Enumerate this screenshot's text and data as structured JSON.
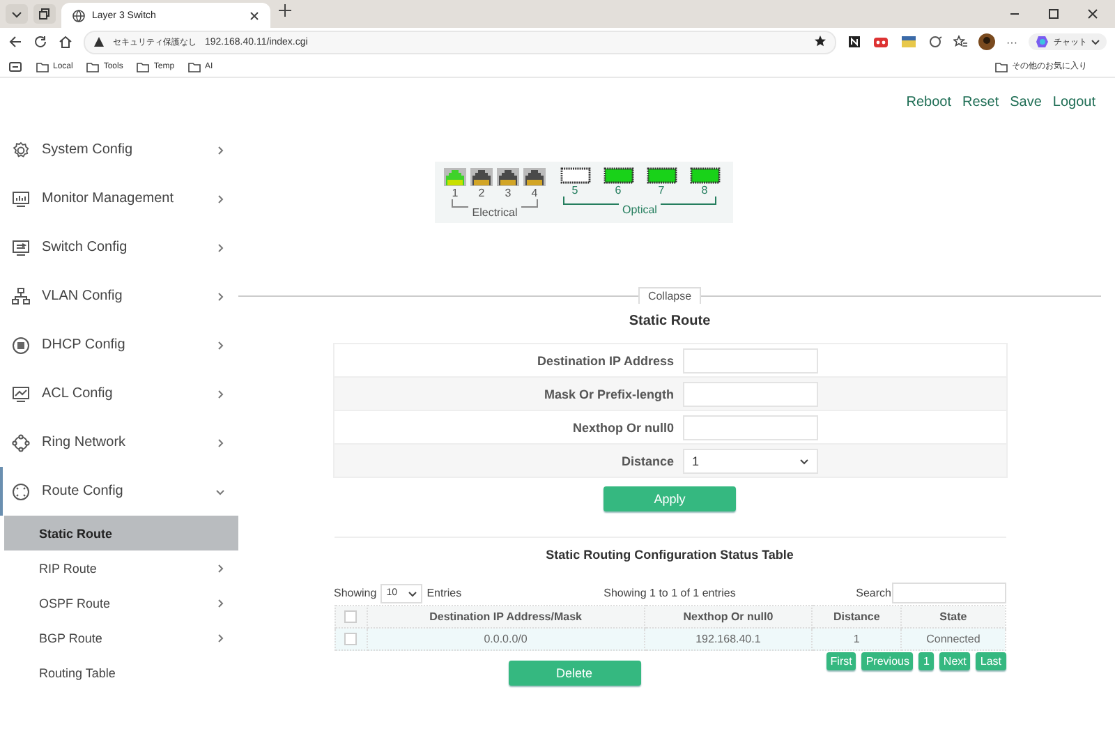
{
  "browser": {
    "tabs": [
      {
        "title": "Layer 3 Switch",
        "selected": true
      }
    ],
    "address": {
      "security_label": "セキュリティ保護なし",
      "url": "192.168.40.11/index.cgi"
    },
    "more_label": "···",
    "chat_label": "チャット",
    "bookmarks": [
      "Local",
      "Tools",
      "Temp",
      "AI"
    ],
    "other_bookmarks": "その他のお気に入り"
  },
  "sidebar": {
    "items": [
      {
        "label": "System Config",
        "expanded": false
      },
      {
        "label": "Monitor Management",
        "expanded": false
      },
      {
        "label": "Switch Config",
        "expanded": false
      },
      {
        "label": "VLAN Config",
        "expanded": false
      },
      {
        "label": "DHCP Config",
        "expanded": false
      },
      {
        "label": "ACL Config",
        "expanded": false
      },
      {
        "label": "Ring Network",
        "expanded": false
      },
      {
        "label": "Route Config",
        "expanded": true,
        "children": [
          {
            "label": "Static Route",
            "selected": true,
            "has_submenu": false
          },
          {
            "label": "RIP Route",
            "selected": false,
            "has_submenu": true
          },
          {
            "label": "OSPF Route",
            "selected": false,
            "has_submenu": true
          },
          {
            "label": "BGP Route",
            "selected": false,
            "has_submenu": true
          },
          {
            "label": "Routing Table",
            "selected": false,
            "has_submenu": false
          }
        ]
      }
    ]
  },
  "header_links": [
    "Reboot",
    "Reset",
    "Save",
    "Logout"
  ],
  "ports": [
    {
      "number": "1",
      "kind": "electrical",
      "link": true
    },
    {
      "number": "2",
      "kind": "electrical",
      "link": false
    },
    {
      "number": "3",
      "kind": "electrical",
      "link": false
    },
    {
      "number": "4",
      "kind": "electrical",
      "link": false
    },
    {
      "number": "5",
      "kind": "optical",
      "link": false
    },
    {
      "number": "6",
      "kind": "optical",
      "link": true
    },
    {
      "number": "7",
      "kind": "optical",
      "link": true
    },
    {
      "number": "8",
      "kind": "optical",
      "link": true
    }
  ],
  "port_groups": [
    {
      "label": "Electrical",
      "kind": "electrical"
    },
    {
      "label": "Optical",
      "kind": "optical"
    }
  ],
  "collapse_label": "Collapse",
  "form": {
    "title": "Static Route",
    "fields": [
      {
        "label": "Destination IP Address",
        "kind": "text"
      },
      {
        "label": "Mask Or Prefix-length",
        "kind": "text"
      },
      {
        "label": "Nexthop Or null0",
        "kind": "text"
      },
      {
        "label": "Distance",
        "kind": "select",
        "value": "1"
      }
    ],
    "apply_button": "Apply"
  },
  "table": {
    "title": "Static Routing Configuration Status Table",
    "length_before": "Showing",
    "length_value": "10",
    "length_after": "Entries",
    "info": "Showing 1 to 1 of 1 entries",
    "search_label": "Search",
    "select_all_checked": false,
    "columns": [
      "Destination IP Address/Mask",
      "Nexthop Or null0",
      "Distance",
      "State"
    ],
    "rows": [
      {
        "selected": false,
        "cells": [
          "0.0.0.0/0",
          "192.168.40.1",
          "1",
          "Connected"
        ]
      }
    ],
    "delete_button": "Delete",
    "pager": [
      "First",
      "Previous",
      "1",
      "Next",
      "Last"
    ]
  }
}
